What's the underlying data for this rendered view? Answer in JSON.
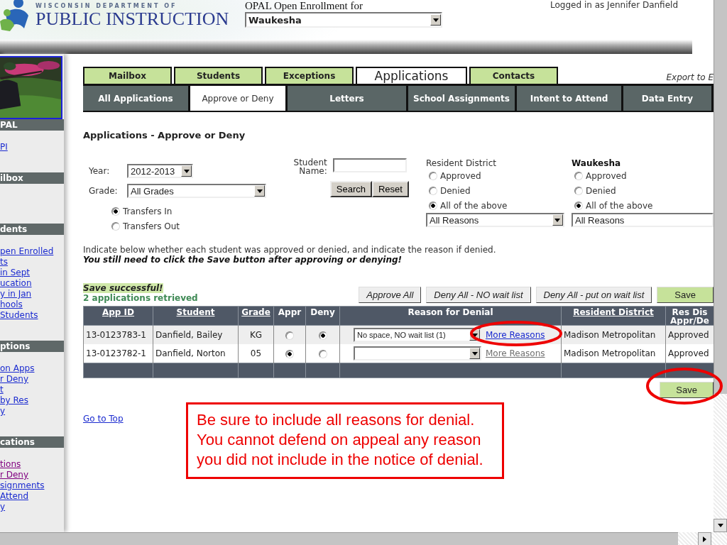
{
  "header": {
    "agency_small": "WISCONSIN DEPARTMENT OF",
    "agency": "PUBLIC INSTRUCTION",
    "app_title": "OPAL Open Enrollment for",
    "district_select": "Waukesha",
    "user": "Logged in as Jennifer Danfield"
  },
  "sidebar": [
    {
      "title": "PAL",
      "links": [
        {
          "label": "PI",
          "visited": false
        }
      ]
    },
    {
      "title": "ilbox"
    },
    {
      "title": "dents",
      "links": [
        {
          "label": "pen Enrolled",
          "visited": false
        },
        {
          "label": "ts",
          "visited": false
        },
        {
          "label": "in Sept",
          "visited": false
        },
        {
          "label": "ucation",
          "visited": false
        },
        {
          "label": "y in Jan",
          "visited": false
        },
        {
          "label": "hools",
          "visited": false
        },
        {
          "label": "Students",
          "visited": false
        }
      ]
    },
    {
      "title": "ptions",
      "links": [
        {
          "label": "on Apps",
          "visited": false
        },
        {
          "label": "r Deny",
          "visited": false
        },
        {
          "label": "t",
          "visited": false
        },
        {
          "label": "by Res",
          "visited": false
        },
        {
          "label": "y",
          "visited": false
        }
      ]
    },
    {
      "title": "cations",
      "links": [
        {
          "label": "tions",
          "visited": true
        },
        {
          "label": "r Deny",
          "visited": true
        },
        {
          "label": "signments",
          "visited": false
        },
        {
          "label": "Attend",
          "visited": false
        },
        {
          "label": "y",
          "visited": false
        }
      ]
    }
  ],
  "tabs": [
    {
      "label": "Mailbox",
      "selected": false
    },
    {
      "label": "Students",
      "selected": false
    },
    {
      "label": "Exceptions",
      "selected": false
    },
    {
      "label": "Applications",
      "selected": true
    },
    {
      "label": "Contacts",
      "selected": false
    }
  ],
  "export_link": "Export to E",
  "subtabs": [
    {
      "label": "All Applications",
      "selected": false
    },
    {
      "label": "Approve or Deny",
      "selected": true
    },
    {
      "label": "Letters",
      "selected": false
    },
    {
      "label": "School Assignments",
      "selected": false
    },
    {
      "label": "Intent to Attend",
      "selected": false
    },
    {
      "label": "Data Entry",
      "selected": false
    }
  ],
  "page_title": "Applications - Approve or Deny",
  "filters": {
    "year_label": "Year:",
    "year": "2012-2013",
    "grade_label": "Grade:",
    "grade": "All Grades",
    "transfers": [
      {
        "label": "Transfers In",
        "selected": true
      },
      {
        "label": "Transfers Out",
        "selected": false
      }
    ],
    "student_label": "Student Name:",
    "search_button": "Search",
    "reset_button": "Reset",
    "groups": [
      {
        "title": "Resident District",
        "bold": false,
        "options": [
          {
            "label": "Approved",
            "selected": false
          },
          {
            "label": "Denied",
            "selected": false
          },
          {
            "label": "All of the above",
            "selected": true
          }
        ],
        "reason": "All Reasons",
        "arrow": true
      },
      {
        "title": "Waukesha",
        "bold": true,
        "options": [
          {
            "label": "Approved",
            "selected": false
          },
          {
            "label": "Denied",
            "selected": false
          },
          {
            "label": "All of the above",
            "selected": true
          }
        ],
        "reason": "All Reasons",
        "arrow": false
      }
    ]
  },
  "instructions": "Indicate below whether each student was approved or denied, and indicate the reason if denied.",
  "instructions_note": "You still need to click the Save button after approving or denying!",
  "status": "Save successful!",
  "count": "2 applications retrieved",
  "bulk_buttons": [
    {
      "label": "Approve All",
      "kind": "plain"
    },
    {
      "label": "Deny All - NO wait list",
      "kind": "plain"
    },
    {
      "label": "Deny All - put on wait list",
      "kind": "plain"
    },
    {
      "label": "Save",
      "kind": "save"
    }
  ],
  "table": {
    "columns": [
      {
        "label": "App ID",
        "sortable": true
      },
      {
        "label": "Student",
        "sortable": true
      },
      {
        "label": "Grade",
        "sortable": true
      },
      {
        "label": "Appr",
        "sortable": false
      },
      {
        "label": "Deny",
        "sortable": false
      },
      {
        "label": "Reason for Denial",
        "sortable": false
      },
      {
        "label": "Resident District",
        "sortable": true
      },
      {
        "label": "Res Dis Appr/De",
        "sortable": false
      }
    ],
    "rows": [
      {
        "app_id": "13-0123783-1",
        "student": "Danfield, Bailey",
        "grade": "KG",
        "approved": false,
        "denied": true,
        "reason": "No space, NO wait list (1)",
        "more_reasons": {
          "label": "More Reasons",
          "disabled": false
        },
        "resident_district": "Madison Metropolitan",
        "res_status": "Approved"
      },
      {
        "app_id": "13-0123782-1",
        "student": "Danfield, Norton",
        "grade": "05",
        "approved": true,
        "denied": false,
        "more_reasons": {
          "label": "More Reasons",
          "disabled": true
        },
        "resident_district": "Madison Metropolitan",
        "res_status": "Approved"
      }
    ]
  },
  "save_bottom": "Save",
  "go_to_top": "Go to Top",
  "note": "Be sure to include all reasons for denial.  You cannot defend on appeal any reason you did not include in the notice of denial."
}
